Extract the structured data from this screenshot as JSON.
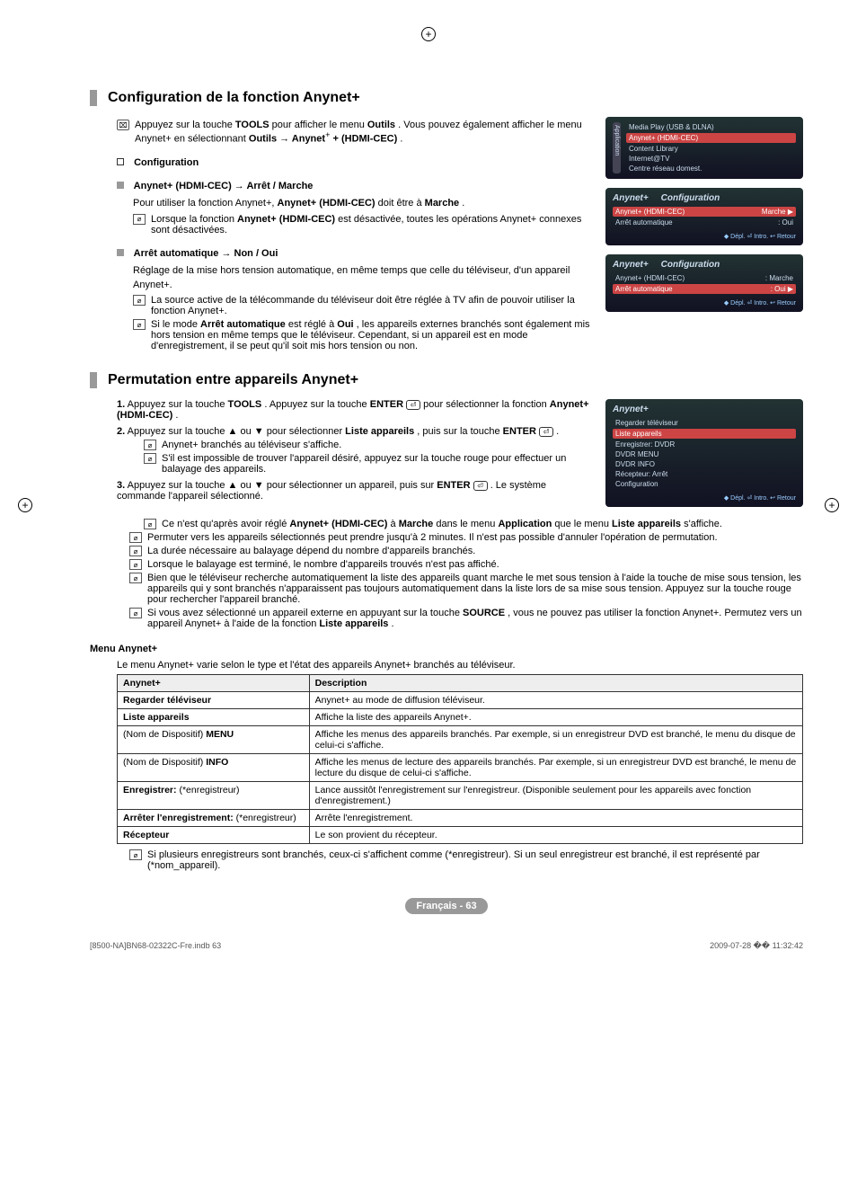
{
  "sections": {
    "config": {
      "title": "Configuration de la fonction Anynet+",
      "tools_note": {
        "p1a": "Appuyez sur la touche ",
        "p1b": "TOOLS",
        "p1c": " pour afficher le menu ",
        "p1d": "Outils",
        "p1e": ". Vous pouvez également afficher le menu Anynet+ en sélectionnant ",
        "p1f": "Outils → Anynet",
        "p1g": "+ (HDMI-CEC)",
        "p1h": "."
      },
      "sub_title": "Configuration",
      "item1": {
        "heading": "Anynet+ (HDMI-CEC) → Arrêt / Marche",
        "line1a": "Pour utiliser la fonction Anynet+, ",
        "line1b": "Anynet+ (HDMI-CEC)",
        "line1c": " doit être à ",
        "line1d": "Marche",
        "line1e": ".",
        "note1a": "Lorsque la fonction ",
        "note1b": "Anynet+ (HDMI-CEC)",
        "note1c": " est désactivée, toutes les opérations Anynet+ connexes sont désactivées."
      },
      "item2": {
        "heading": "Arrêt automatique → Non / Oui",
        "line1": "Réglage de la mise hors tension automatique, en même temps que celle du téléviseur, d'un appareil Anynet+.",
        "note1": "La source active de la télécommande du téléviseur doit être réglée à TV afin de pouvoir utiliser la fonction Anynet+.",
        "note2a": "Si le mode ",
        "note2b": "Arrêt automatique",
        "note2c": " est réglé à ",
        "note2d": "Oui",
        "note2e": ", les appareils externes branchés sont également mis hors tension en même temps que le téléviseur. Cependant, si un appareil est en mode d'enregistrement, il se peut qu'il soit mis hors tension ou non."
      }
    },
    "permutation": {
      "title": "Permutation entre appareils Anynet+",
      "step1a": "Appuyez sur la touche ",
      "step1b": "TOOLS",
      "step1c": ". Appuyez sur la touche ",
      "step1d": "ENTER",
      "step1e": " pour sélectionner la fonction ",
      "step1f": "Anynet+ (HDMI-CEC)",
      "step1g": ".",
      "step2a": "Appuyez sur la touche ▲ ou ▼ pour sélectionner ",
      "step2b": "Liste appareils",
      "step2c": ", puis sur la touche ",
      "step2d": "ENTER",
      "step2e": ".",
      "step2_n1": "Anynet+ branchés au téléviseur s'affiche.",
      "step2_n2": "S'il est impossible de trouver l'appareil désiré, appuyez sur la touche rouge pour effectuer un balayage des appareils.",
      "step3a": "Appuyez sur la touche ▲ ou ▼ pour sélectionner un appareil, puis sur ",
      "step3b": "ENTER",
      "step3c": ". Le système commande l'appareil sélectionné.",
      "step3_n1a": "Ce n'est qu'après avoir réglé ",
      "step3_n1b": "Anynet+ (HDMI-CEC)",
      "step3_n1c": " à ",
      "step3_n1d": "Marche",
      "step3_n1e": " dans le menu ",
      "step3_n1f": "Application",
      "step3_n1g": " que le menu ",
      "step3_n1h": "Liste appareils",
      "step3_n1i": " s'affiche.",
      "bullet1": "Permuter vers les appareils sélectionnés peut prendre jusqu'à 2 minutes. Il n'est pas possible d'annuler l'opération de permutation.",
      "bullet2": "La durée nécessaire au balayage dépend du nombre d'appareils branchés.",
      "bullet3": "Lorsque le balayage est terminé, le nombre d'appareils trouvés n'est pas affiché.",
      "bullet4": "Bien que le téléviseur recherche automatiquement la liste des appareils quant marche le met sous tension à l'aide la touche de mise sous tension, les appareils qui y sont branchés n'apparaissent pas toujours automatiquement dans la liste lors de sa mise sous tension. Appuyez sur la touche rouge pour rechercher l'appareil branché.",
      "bullet5a": "Si vous avez sélectionné un appareil externe en appuyant sur la touche ",
      "bullet5b": "SOURCE",
      "bullet5c": ", vous ne pouvez pas utiliser la fonction Anynet+. Permutez vers un appareil Anynet+ à l'aide de la fonction ",
      "bullet5d": "Liste appareils",
      "bullet5e": "."
    },
    "menu": {
      "heading": "Menu Anynet+",
      "intro": "Le menu Anynet+ varie selon le type et l'état des appareils Anynet+ branchés au téléviseur.",
      "th1": "Anynet+",
      "th2": "Description",
      "rows": [
        {
          "c1": "Regarder téléviseur",
          "c2": "Anynet+ au mode de diffusion téléviseur."
        },
        {
          "c1": "Liste appareils",
          "c2": "Affiche la liste des appareils Anynet+."
        },
        {
          "c1a": "(Nom de Dispositif) ",
          "c1b": "MENU",
          "c2": "Affiche les menus des appareils branchés. Par exemple, si un enregistreur DVD est branché, le menu du disque de celui-ci s'affiche."
        },
        {
          "c1a": "(Nom de Dispositif) ",
          "c1b": "INFO",
          "c2": "Affiche les menus de lecture des appareils branchés. Par exemple, si un enregistreur DVD est branché, le menu de lecture du disque de celui-ci s'affiche."
        },
        {
          "c1a": "Enregistrer:",
          "c1b": " (*enregistreur)",
          "c2": "Lance aussitôt l'enregistrement sur l'enregistreur. (Disponible seulement pour les appareils avec fonction d'enregistrement.)"
        },
        {
          "c1a": "Arrêter l'enregistrement:",
          "c1b": " (*enregistreur)",
          "c2": "Arrête l'enregistrement."
        },
        {
          "c1": "Récepteur",
          "c2": "Le son provient du récepteur."
        }
      ],
      "foot_note": "Si plusieurs enregistreurs sont branchés, ceux-ci s'affichent comme (*enregistreur). Si un seul enregistreur est branché, il est représenté par (*nom_appareil)."
    }
  },
  "osd1": {
    "side": "Application",
    "r1": "Media Play (USB & DLNA)",
    "r2": "Anynet+ (HDMI-CEC)",
    "r3": "Content Library",
    "r4": "Internet@TV",
    "r5": "Centre réseau domest."
  },
  "osd2": {
    "title": "Anynet+",
    "sub": "Configuration",
    "r1l": "Anynet+ (HDMI-CEC)",
    "r1r": "Marche",
    "r2l": "Arrêt automatique",
    "r2r": ": Oui",
    "foot": "◆ Dépl.    ⏎ Intro.    ↩ Retour"
  },
  "osd3": {
    "title": "Anynet+",
    "sub": "Configuration",
    "r1l": "Anynet+ (HDMI-CEC)",
    "r1r": ": Marche",
    "r2l": "Arrêt automatique",
    "r2r": ": Oui",
    "foot": "◆ Dépl.    ⏎ Intro.    ↩ Retour"
  },
  "osd4": {
    "title": "Anynet+",
    "r1": "Regarder téléviseur",
    "r2": "Liste appareils",
    "r3": "Enregistrer: DVDR",
    "r4": "DVDR MENU",
    "r5": "DVDR INFO",
    "r6": "Récepteur: Arrêt",
    "r7": "Configuration",
    "foot": "◆ Dépl.    ⏎ Intro.    ↩ Retour"
  },
  "page_foot": "Français - 63",
  "print_left": "[8500-NA]BN68-02322C-Fre.indb   63",
  "print_right": "2009-07-28   �� 11:32:42"
}
